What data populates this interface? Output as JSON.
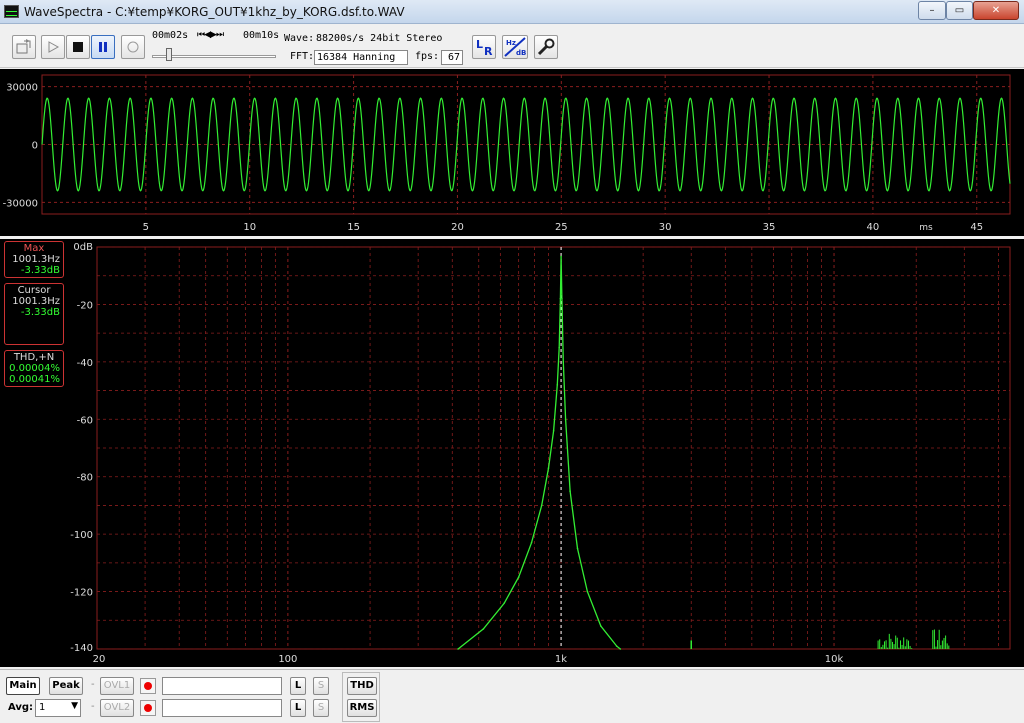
{
  "window": {
    "title": "WaveSpectra - C:¥temp¥KORG_OUT¥1khz_by_KORG.dsf.to.WAV",
    "minimize": "–",
    "restore": "▭",
    "close": "✕"
  },
  "toolbar": {
    "time_start": "00m02s",
    "transport": "⏮◀▶⏭",
    "time_end": "00m10s",
    "wave_label": "Wave:",
    "wave_value": "88200s/s 24bit Stereo",
    "fft_label": "FFT:",
    "fft_value": "16384 Hanning",
    "fps_label": "fps:",
    "fps_value": "67",
    "lr_label": "LR",
    "hz_label": "Hz",
    "db_label": "dB",
    "position_fraction": 0.12
  },
  "colors": {
    "background": "#000000",
    "grid": "#8a1e1e",
    "trace": "#33ee33",
    "axis_label": "#dddddd",
    "cursor": "#ffffff"
  },
  "icons": [
    "open-file-icon",
    "play-icon",
    "stop-icon",
    "pause-icon",
    "record-icon",
    "lr-channel-icon",
    "hz-db-icon",
    "settings-wrench-icon"
  ],
  "wave_chart": {
    "type": "line",
    "y_ticks": [
      "30000",
      "0",
      "-30000"
    ],
    "ylim": [
      -36000,
      36000
    ],
    "x_ticks": [
      "5",
      "10",
      "15",
      "20",
      "25",
      "30",
      "35",
      "40",
      "45"
    ],
    "x_unit": "ms",
    "xlim": [
      0,
      46.6
    ],
    "amplitude": 24000,
    "frequency_hz": 1001.3
  },
  "info_boxes": {
    "max": {
      "title": "Max",
      "freq": "1001.3Hz",
      "level": "-3.33dB"
    },
    "cursor": {
      "title": "Cursor",
      "freq": "1001.3Hz",
      "level": "-3.33dB"
    },
    "thd": {
      "title": "THD,+N",
      "thd": "0.00004%",
      "thdn": "0.00041%"
    }
  },
  "chart_data": {
    "type": "line",
    "x_scale": "log",
    "xlim": [
      20,
      44100
    ],
    "ylim": [
      -140,
      0
    ],
    "x_ticks": [
      {
        "value": 20,
        "label": "20"
      },
      {
        "value": 100,
        "label": "100"
      },
      {
        "value": 1000,
        "label": "1k"
      },
      {
        "value": 10000,
        "label": "10k"
      }
    ],
    "y_ticks": [
      {
        "value": 0,
        "label": "0dB"
      },
      {
        "value": -20,
        "label": "-20"
      },
      {
        "value": -40,
        "label": "-40"
      },
      {
        "value": -60,
        "label": "-60"
      },
      {
        "value": -80,
        "label": "-80"
      },
      {
        "value": -100,
        "label": "-100"
      },
      {
        "value": -120,
        "label": "-120"
      },
      {
        "value": -140,
        "label": "-140"
      }
    ],
    "grid": true,
    "cursor_hz": 1001.3,
    "series": [
      {
        "x": [
          420,
          520,
          620,
          700,
          780,
          850,
          900,
          940,
          970,
          985,
          995,
          1001.3,
          1008,
          1020,
          1040,
          1080,
          1150,
          1250,
          1400,
          1600,
          1650
        ],
        "y": [
          -140,
          -133,
          -124,
          -115,
          -103,
          -90,
          -77,
          -64,
          -48,
          -35,
          -18,
          -3.33,
          -18,
          -40,
          -60,
          -85,
          -105,
          -120,
          -132,
          -139,
          -140
        ]
      }
    ],
    "spurs": [
      {
        "x": 3000,
        "y": -137
      }
    ],
    "noise_clusters": [
      {
        "x_from": 14500,
        "x_to": 19500,
        "y_top": -134
      },
      {
        "x_from": 23000,
        "x_to": 26500,
        "y_top": -133
      }
    ]
  },
  "bottom": {
    "main": "Main",
    "peak": "Peak",
    "ovl1": "OVL1",
    "ovl2": "OVL2",
    "l": "L",
    "s": "S",
    "thd": "THD",
    "rms": "RMS",
    "avg_label": "Avg:",
    "avg_value": "1",
    "dash": "-"
  }
}
